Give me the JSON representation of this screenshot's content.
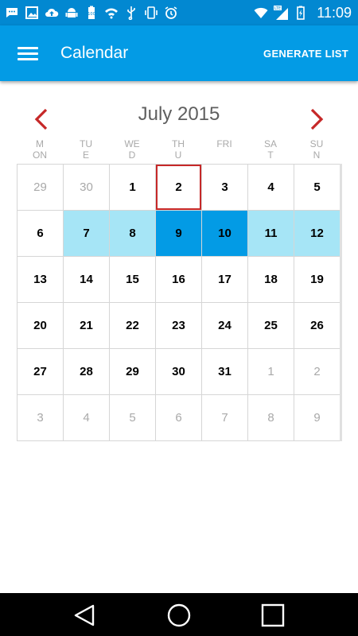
{
  "status_bar": {
    "time": "11:09",
    "icons": [
      "chat-icon",
      "image-icon",
      "cloud-upload-icon",
      "android-icon",
      "battery-100-icon",
      "wifi-calling-icon",
      "usb-icon",
      "vibrate-icon",
      "alarm-icon",
      "wifi-icon",
      "lte-signal-icon",
      "battery-charging-icon"
    ]
  },
  "app_bar": {
    "title": "Calendar",
    "action_label": "GENERATE LIST",
    "color": "#039be5"
  },
  "calendar": {
    "month_label": "July 2015",
    "weekdays": [
      {
        "line1": "M",
        "line2": "ON"
      },
      {
        "line1": "TU",
        "line2": "E"
      },
      {
        "line1": "WE",
        "line2": "D"
      },
      {
        "line1": "TH",
        "line2": "U"
      },
      {
        "line1": "FRI",
        "line2": ""
      },
      {
        "line1": "SA",
        "line2": "T"
      },
      {
        "line1": "SU",
        "line2": "N"
      }
    ],
    "weeks": [
      [
        {
          "d": "29",
          "s": "other"
        },
        {
          "d": "30",
          "s": "other"
        },
        {
          "d": "1",
          "s": ""
        },
        {
          "d": "2",
          "s": "today"
        },
        {
          "d": "3",
          "s": ""
        },
        {
          "d": "4",
          "s": ""
        },
        {
          "d": "5",
          "s": ""
        }
      ],
      [
        {
          "d": "6",
          "s": ""
        },
        {
          "d": "7",
          "s": "range"
        },
        {
          "d": "8",
          "s": "range"
        },
        {
          "d": "9",
          "s": "selected"
        },
        {
          "d": "10",
          "s": "selected"
        },
        {
          "d": "11",
          "s": "range"
        },
        {
          "d": "12",
          "s": "range"
        }
      ],
      [
        {
          "d": "13",
          "s": ""
        },
        {
          "d": "14",
          "s": ""
        },
        {
          "d": "15",
          "s": ""
        },
        {
          "d": "16",
          "s": ""
        },
        {
          "d": "17",
          "s": ""
        },
        {
          "d": "18",
          "s": ""
        },
        {
          "d": "19",
          "s": ""
        }
      ],
      [
        {
          "d": "20",
          "s": ""
        },
        {
          "d": "21",
          "s": ""
        },
        {
          "d": "22",
          "s": ""
        },
        {
          "d": "23",
          "s": ""
        },
        {
          "d": "24",
          "s": ""
        },
        {
          "d": "25",
          "s": ""
        },
        {
          "d": "26",
          "s": ""
        }
      ],
      [
        {
          "d": "27",
          "s": ""
        },
        {
          "d": "28",
          "s": ""
        },
        {
          "d": "29",
          "s": ""
        },
        {
          "d": "30",
          "s": ""
        },
        {
          "d": "31",
          "s": ""
        },
        {
          "d": "1",
          "s": "other"
        },
        {
          "d": "2",
          "s": "other"
        }
      ],
      [
        {
          "d": "3",
          "s": "other"
        },
        {
          "d": "4",
          "s": "other"
        },
        {
          "d": "5",
          "s": "other"
        },
        {
          "d": "6",
          "s": "other"
        },
        {
          "d": "7",
          "s": "other"
        },
        {
          "d": "8",
          "s": "other"
        },
        {
          "d": "9",
          "s": "other"
        }
      ]
    ],
    "colors": {
      "range": "#a6e5f6",
      "selected": "#039be5",
      "today_border": "#c62828",
      "arrow": "#c62828"
    }
  },
  "nav_bar": {
    "buttons": [
      "back-icon",
      "home-icon",
      "recents-icon"
    ]
  }
}
